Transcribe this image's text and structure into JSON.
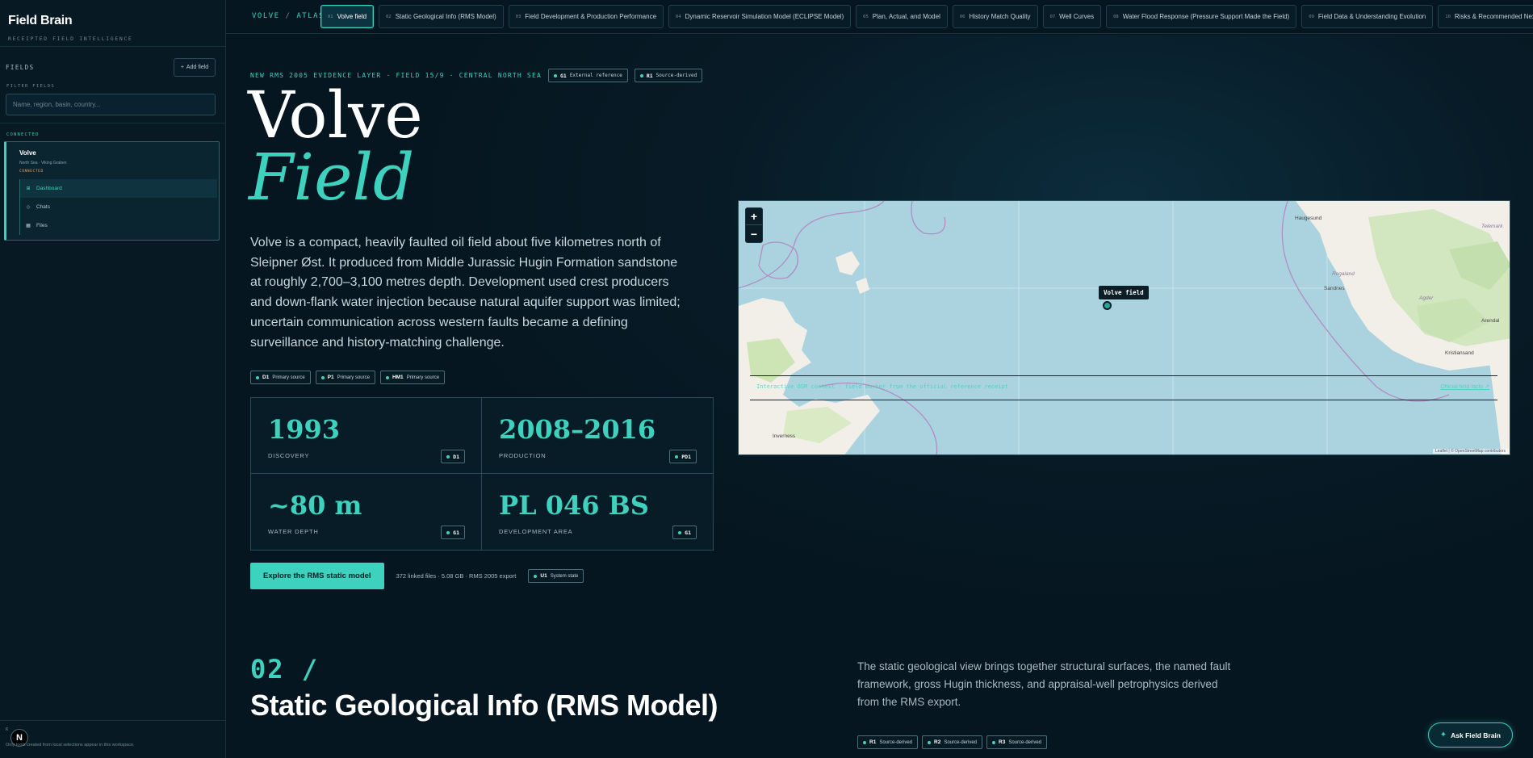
{
  "sidebar": {
    "brand": "Field Brain",
    "tagline": "RECEIPTED FIELD INTELLIGENCE",
    "fields_label": "FIELDS",
    "add_field": "Add field",
    "filter_label": "FILTER FIELDS",
    "filter_placeholder": "Name, region, basin, country...",
    "connected_label": "CONNECTED",
    "field": {
      "name": "Volve",
      "region": "North Sea · Viking Graben",
      "status": "CONNECTED"
    },
    "nav": [
      {
        "label": "Dashboard",
        "icon": "dashboard-icon"
      },
      {
        "label": "Chats",
        "icon": "chat-icon"
      },
      {
        "label": "Files",
        "icon": "files-icon"
      }
    ],
    "bottom_label": "R",
    "bottom_note": "Only tools created from local selections appear in this workspace."
  },
  "topbar": {
    "crumb_a": "VOLVE",
    "crumb_sep": "/",
    "crumb_b": "ATLAS",
    "tabs": [
      {
        "num": "01",
        "label": "Volve field"
      },
      {
        "num": "02",
        "label": "Static Geological Info (RMS Model)"
      },
      {
        "num": "03",
        "label": "Field Development & Production Performance"
      },
      {
        "num": "04",
        "label": "Dynamic Reservoir Simulation Model (ECLIPSE Model)"
      },
      {
        "num": "05",
        "label": "Plan, Actual, and Model"
      },
      {
        "num": "06",
        "label": "History Match Quality"
      },
      {
        "num": "07",
        "label": "Well Curves"
      },
      {
        "num": "08",
        "label": "Water Flood Response (Pressure Support Made the Field)"
      },
      {
        "num": "09",
        "label": "Field Data & Understanding Evolution"
      },
      {
        "num": "10",
        "label": "Risks & Recommended Next-Step Actions"
      }
    ]
  },
  "hero": {
    "kicker": "NEW RMS 2005 EVIDENCE LAYER · FIELD 15/9 · CENTRAL NORTH SEA",
    "kicker_chips": [
      {
        "code": "G1",
        "label": "External reference"
      },
      {
        "code": "R1",
        "label": "Source-derived"
      }
    ],
    "title_1": "Volve",
    "title_2": "Field",
    "description": "Volve is a compact, heavily faulted oil field about five kilometres north of Sleipner Øst. It produced from Middle Jurassic Hugin Formation sandstone at roughly 2,700–3,100 metres depth. Development used crest producers and down-flank water injection because natural aquifer support was limited; uncertain communication across western faults became a defining surveillance and history-matching challenge.",
    "source_chips": [
      {
        "code": "D1",
        "label": "Primary source"
      },
      {
        "code": "P1",
        "label": "Primary source"
      },
      {
        "code": "HM1",
        "label": "Primary source"
      }
    ],
    "stats": [
      {
        "value": "1993",
        "label": "DISCOVERY",
        "chip": "D1"
      },
      {
        "value": "2008–2016",
        "label": "PRODUCTION",
        "chip": "PD1"
      },
      {
        "value": "~80 m",
        "label": "WATER DEPTH",
        "chip": "G1"
      },
      {
        "value": "PL 046 BS",
        "label": "DEVELOPMENT AREA",
        "chip": "G1"
      }
    ],
    "cta": "Explore the RMS static model",
    "cta_meta": "372 linked files · 5.08 GB · RMS 2005 export",
    "cta_chip": {
      "code": "U1",
      "label": "System state"
    }
  },
  "map": {
    "zoom_in": "+",
    "zoom_out": "−",
    "marker_label": "Volve field",
    "caption": "Interactive OSM context · field marker from the official reference receipt",
    "link": "Official field facts ↗",
    "attribution": "Leaflet | © OpenStreetMap contributors",
    "cities": {
      "haugesund": "Haugesund",
      "sandnes": "Sandnes",
      "rogaland": "Rogaland",
      "agder": "Agder",
      "arendal": "Arendal",
      "kristiansand": "Kristiansand",
      "telemark": "Telemark",
      "inverness": "Inverness"
    }
  },
  "section2": {
    "number": "02 /",
    "title": "Static Geological Info (RMS Model)",
    "description": "The static geological view brings together structural surfaces, the named fault framework, gross Hugin thickness, and appraisal-well petrophysics derived from the RMS export.",
    "chips": [
      {
        "code": "R1",
        "label": "Source-derived"
      },
      {
        "code": "R2",
        "label": "Source-derived"
      },
      {
        "code": "R3",
        "label": "Source-derived"
      }
    ]
  },
  "ask_button": "Ask Field Brain",
  "colors": {
    "accent": "#3dd1be",
    "background": "#061620",
    "status_connected": "#32d1a0",
    "status_orange": "#f3a05a"
  }
}
